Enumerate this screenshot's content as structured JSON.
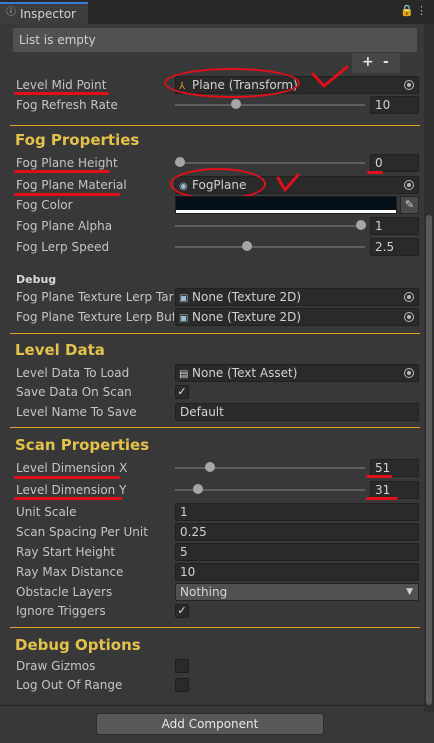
{
  "window": {
    "tab_title": "Inspector",
    "tab_icon": "info-icon",
    "toolbar_icons": [
      "lock-icon",
      "menu-icon"
    ]
  },
  "list": {
    "empty_text": "List is empty",
    "add_label": "+",
    "remove_label": "-"
  },
  "fields": {
    "level_mid_point": {
      "label": "Level Mid Point",
      "value": "Plane (Transform)"
    },
    "fog_refresh_rate": {
      "label": "Fog Refresh Rate",
      "value": "10",
      "slider_fraction": 0.38
    }
  },
  "fog_properties": {
    "header": "Fog Properties",
    "fog_plane_height": {
      "label": "Fog Plane Height",
      "value": "0",
      "slider_fraction": 0.0
    },
    "fog_plane_material": {
      "label": "Fog Plane Material",
      "value": "FogPlane"
    },
    "fog_color": {
      "label": "Fog Color",
      "color": "#061018"
    },
    "fog_plane_alpha": {
      "label": "Fog Plane Alpha",
      "value": "1",
      "slider_fraction": 1.0
    },
    "fog_lerp_speed": {
      "label": "Fog Lerp Speed",
      "value": "2.5",
      "slider_fraction": 0.38
    }
  },
  "debug": {
    "header": "Debug",
    "texture_target": {
      "label": "Fog Plane Texture Lerp Targ",
      "value": "None (Texture 2D)"
    },
    "texture_buffer": {
      "label": "Fog Plane Texture Lerp Buff",
      "value": "None (Texture 2D)"
    }
  },
  "level_data": {
    "header": "Level Data",
    "level_data_to_load": {
      "label": "Level Data To Load",
      "value": "None (Text Asset)"
    },
    "save_data_on_scan": {
      "label": "Save Data On Scan",
      "checked": true
    },
    "level_name_to_save": {
      "label": "Level Name To Save",
      "value": "Default"
    }
  },
  "scan_properties": {
    "header": "Scan Properties",
    "level_dimension_x": {
      "label": "Level Dimension X",
      "value": "51",
      "slider_fraction": 0.19
    },
    "level_dimension_y": {
      "label": "Level Dimension Y",
      "value": "31",
      "slider_fraction": 0.12
    },
    "unit_scale": {
      "label": "Unit Scale",
      "value": "1"
    },
    "scan_spacing": {
      "label": "Scan Spacing Per Unit",
      "value": "0.25"
    },
    "ray_start_height": {
      "label": "Ray Start Height",
      "value": "5"
    },
    "ray_max_distance": {
      "label": "Ray Max Distance",
      "value": "10"
    },
    "obstacle_layers": {
      "label": "Obstacle Layers",
      "value": "Nothing"
    },
    "ignore_triggers": {
      "label": "Ignore Triggers",
      "checked": true
    }
  },
  "debug_options": {
    "header": "Debug Options",
    "draw_gizmos": {
      "label": "Draw Gizmos",
      "checked": false
    },
    "log_out_of_range": {
      "label": "Log Out Of Range",
      "checked": false
    }
  },
  "footer": {
    "add_component": "Add Component"
  },
  "colors": {
    "accent_header": "#e3c24c",
    "annotation_red": "#e0101a",
    "separator": "#e0a020"
  }
}
